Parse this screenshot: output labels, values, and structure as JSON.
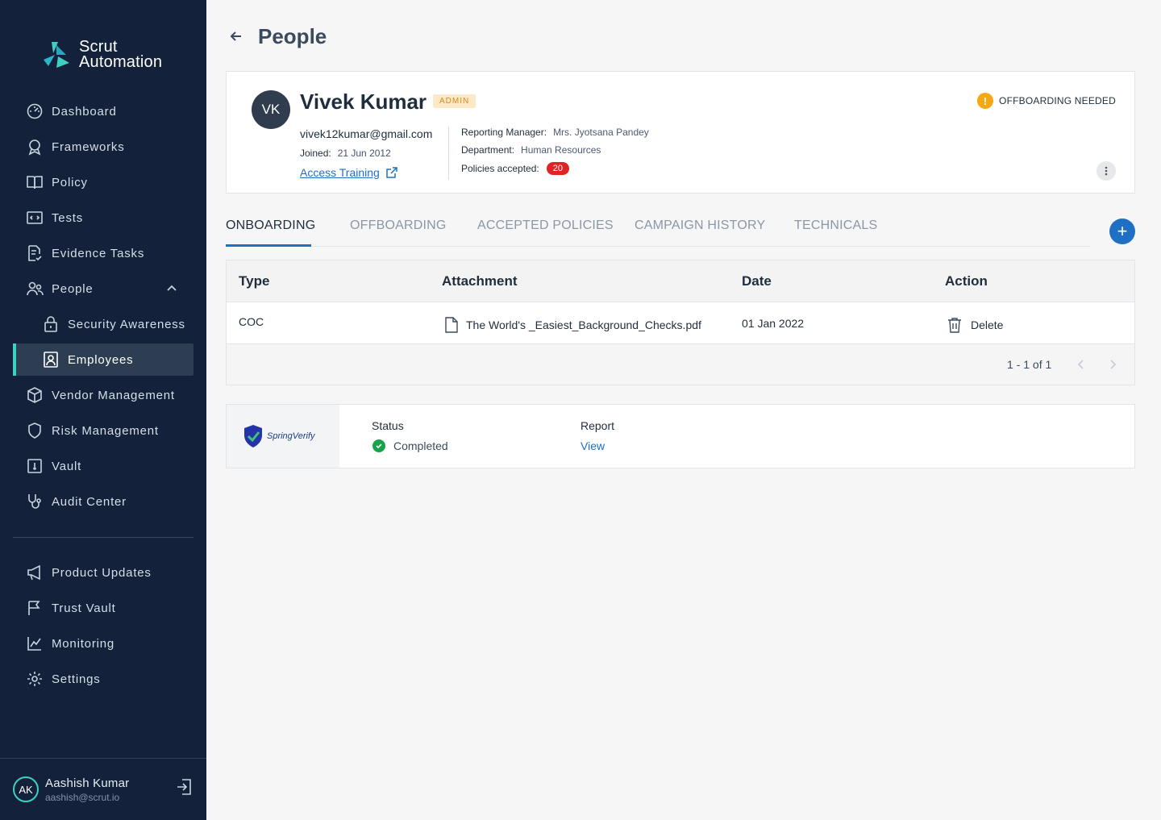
{
  "brand": {
    "line1": "Scrut",
    "line2": "Automation"
  },
  "sidebar": {
    "items": [
      {
        "label": "Dashboard",
        "icon": "dashboard-icon"
      },
      {
        "label": "Frameworks",
        "icon": "award-icon"
      },
      {
        "label": "Policy",
        "icon": "book-icon"
      },
      {
        "label": "Tests",
        "icon": "code-icon"
      },
      {
        "label": "Evidence Tasks",
        "icon": "document-check-icon"
      },
      {
        "label": "People",
        "icon": "people-icon"
      },
      {
        "label": "Security Awareness",
        "icon": "lock-icon"
      },
      {
        "label": "Employees",
        "icon": "id-card-icon"
      },
      {
        "label": "Vendor Management",
        "icon": "cube-icon"
      },
      {
        "label": "Risk Management",
        "icon": "shield-icon"
      },
      {
        "label": "Vault",
        "icon": "vault-icon"
      },
      {
        "label": "Audit Center",
        "icon": "stethoscope-icon"
      }
    ],
    "bottom_items": [
      {
        "label": "Product Updates",
        "icon": "megaphone-icon"
      },
      {
        "label": "Trust Vault",
        "icon": "flag-icon"
      },
      {
        "label": "Monitoring",
        "icon": "chart-icon"
      },
      {
        "label": "Settings",
        "icon": "gear-icon"
      }
    ],
    "user": {
      "initials": "AK",
      "name": "Aashish Kumar",
      "email": "aashish@scrut.io"
    }
  },
  "page": {
    "title": "People"
  },
  "profile": {
    "initials": "VK",
    "name": "Vivek Kumar",
    "role_badge": "ADMIN",
    "email": "vivek12kumar@gmail.com",
    "joined_label": "Joined:",
    "joined_value": "21 Jun 2012",
    "access_training": "Access Training",
    "manager_label": "Reporting Manager:",
    "manager_value": "Mrs. Jyotsana Pandey",
    "department_label": "Department:",
    "department_value": "Human Resources",
    "policies_label": "Policies accepted:",
    "policies_value": "20",
    "status": "OFFBOARDING NEEDED",
    "status_color": "#f4a812"
  },
  "tabs": [
    "ONBOARDING",
    "OFFBOARDING",
    "ACCEPTED POLICIES",
    "CAMPAIGN HISTORY",
    "TECHNICALS"
  ],
  "active_tab": "ONBOARDING",
  "table": {
    "columns": [
      "Type",
      "Attachment",
      "Date",
      "Action"
    ],
    "rows": [
      {
        "type": "COC",
        "attachment": "The World's _Easiest_Background_Checks.pdf",
        "date": "01 Jan 2022",
        "action": "Delete"
      }
    ],
    "pagination": "1 - 1 of 1"
  },
  "background_check": {
    "provider_logo_text": "SpringVerify",
    "status_label": "Status",
    "status_value": "Completed",
    "report_label": "Report",
    "report_link": "View"
  },
  "colors": {
    "sidebar_bg": "#13223a",
    "accent": "#3ed1c1",
    "primary": "#1f6fc5",
    "danger": "#e02424"
  }
}
